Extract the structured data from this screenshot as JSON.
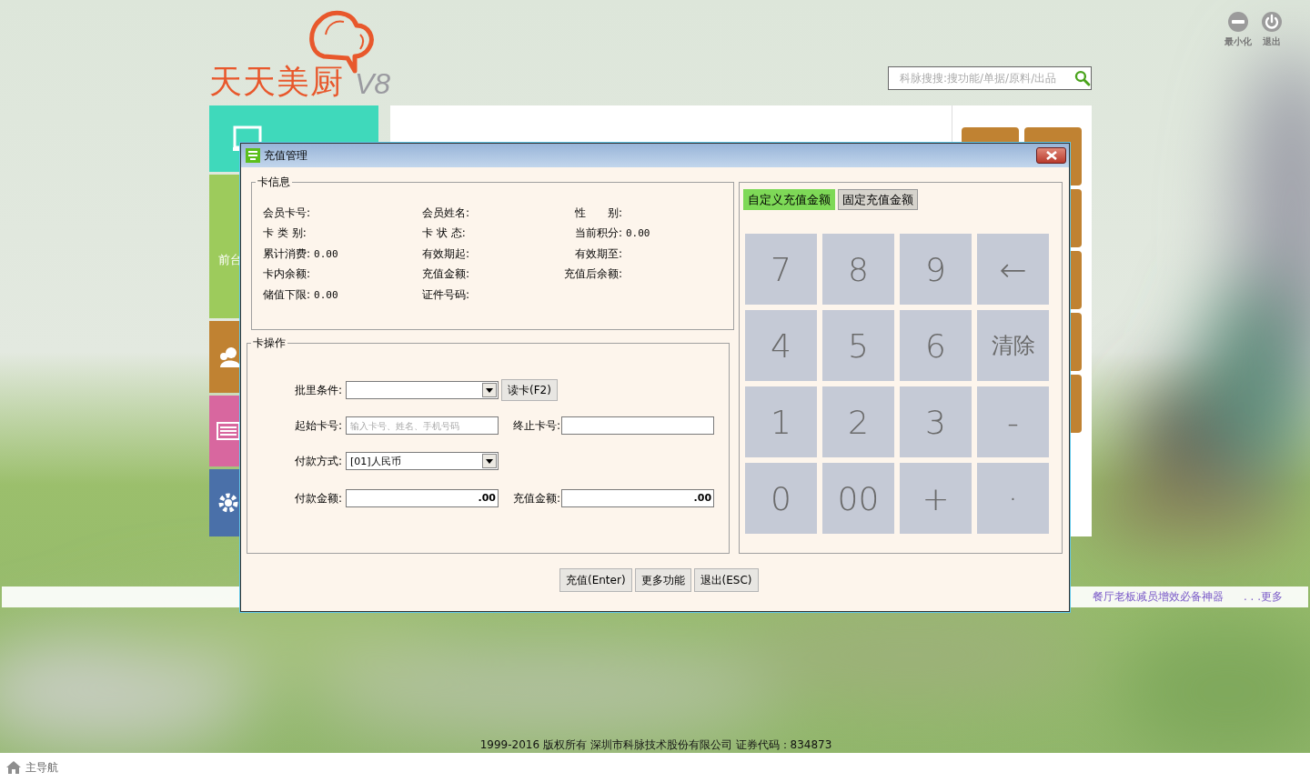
{
  "header": {
    "logo": {
      "brand": "天天美厨",
      "version": "V8"
    },
    "window_buttons": [
      {
        "kind": "minimize",
        "label": "最小化"
      },
      {
        "kind": "exit",
        "label": "退出"
      }
    ],
    "search": {
      "placeholder": "科脉搜搜:搜功能/单据/原料/出品"
    }
  },
  "left_tiles": [
    {
      "kind": "desktop",
      "color": "#3fd9bb"
    },
    {
      "kind": "front",
      "label": "前台",
      "color": "#9dcb5c"
    },
    {
      "kind": "people",
      "color": "#c08232"
    },
    {
      "kind": "keyboard",
      "color": "#d8679f"
    },
    {
      "kind": "gear",
      "color": "#4a70a9"
    }
  ],
  "ticker": {
    "headline": "餐厅老板减员增效必备神器",
    "more": ". . .更多"
  },
  "copyright": "1999-2016  版权所有  深圳市科脉技术股份有限公司  证券代码：834873",
  "nav": {
    "label": "主导航"
  },
  "dialog": {
    "title": "充值管理",
    "card_info": {
      "title": "卡信息",
      "fields": [
        {
          "label": "会员卡号:"
        },
        {
          "label": "会员姓名:"
        },
        {
          "label": "性　　别:"
        },
        {
          "label": "卡 类 别:"
        },
        {
          "label": "卡 状 态:"
        },
        {
          "label": "当前积分:",
          "value": "0.00"
        },
        {
          "label": "累计消费:",
          "value": "0.00"
        },
        {
          "label": "有效期起:"
        },
        {
          "label": "有效期至:"
        },
        {
          "label": "卡内余额:"
        },
        {
          "label": "充值金额:"
        },
        {
          "label": "充值后余额:"
        },
        {
          "label": "储值下限:",
          "value": "0.00"
        },
        {
          "label": "证件号码:"
        }
      ]
    },
    "card_ops": {
      "title": "卡操作",
      "rows": [
        [
          {
            "kind": "dropdown",
            "label": "批里条件:"
          },
          {
            "kind": "button",
            "label": "读卡(F2)"
          }
        ],
        [
          {
            "kind": "input",
            "label": "起始卡号:",
            "placeholder": "输入卡号、姓名、手机号码"
          },
          {
            "kind": "input",
            "label": "终止卡号:"
          }
        ],
        [
          {
            "kind": "dropdown",
            "label": "付款方式:",
            "value": "[01]人民币"
          }
        ],
        [
          {
            "kind": "amount",
            "label": "付款金额:",
            "value": ".00"
          },
          {
            "kind": "amount",
            "label": "充值金额:",
            "value": ".00"
          }
        ]
      ]
    },
    "keypad": {
      "tabs": [
        {
          "label": "自定义充值金额",
          "selected": true
        },
        {
          "label": "固定充值金额",
          "selected": false
        }
      ],
      "keys": [
        "7",
        "8",
        "9",
        "←",
        "4",
        "5",
        "6",
        "清除",
        "1",
        "2",
        "3",
        "-",
        "0",
        "00",
        "+",
        "·"
      ]
    },
    "buttons": [
      "充值(Enter)",
      "更多功能",
      "退出(ESC)"
    ]
  }
}
